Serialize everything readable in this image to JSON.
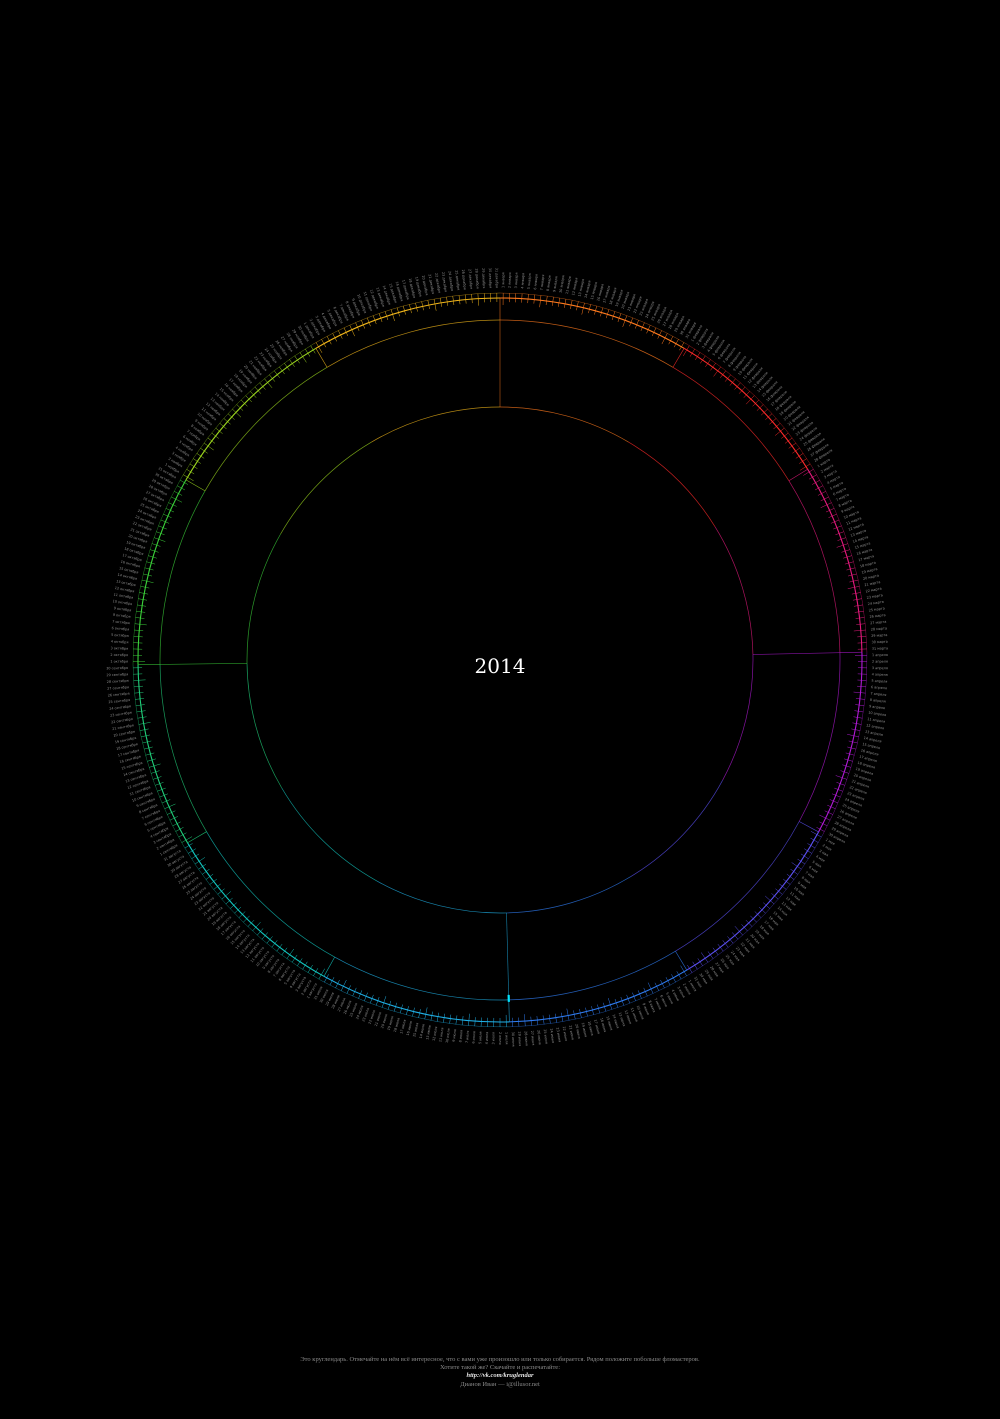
{
  "year": "2014",
  "months": [
    {
      "name": "января",
      "days": 31,
      "color": "#ff7a1e"
    },
    {
      "name": "февраля",
      "days": 28,
      "color": "#ff2a2a"
    },
    {
      "name": "марта",
      "days": 31,
      "color": "#e6197d"
    },
    {
      "name": "апреля",
      "days": 30,
      "color": "#b11ad6"
    },
    {
      "name": "мая",
      "days": 31,
      "color": "#5a4ff0"
    },
    {
      "name": "июня",
      "days": 30,
      "color": "#2f7bf0"
    },
    {
      "name": "июля",
      "days": 31,
      "color": "#1fb0e6"
    },
    {
      "name": "августа",
      "days": 31,
      "color": "#12c6bf"
    },
    {
      "name": "сентября",
      "days": 30,
      "color": "#20cf7a"
    },
    {
      "name": "октября",
      "days": 31,
      "color": "#3bd23a"
    },
    {
      "name": "ноября",
      "days": 30,
      "color": "#9bd51e"
    },
    {
      "name": "декабря",
      "days": 31,
      "color": "#f0b51a"
    }
  ],
  "today_marker": {
    "month": "июля",
    "day": 1,
    "color": "#00e5ff"
  },
  "footer": {
    "line1": "Это круглендарь. Отмечайте на нём всё интересное, что с вами уже произошло или только собирается. Рядом положите побольше фломастеров.",
    "line2": "Хотите такой же? Скачайте и распечатайте:",
    "link": "http://vk.com/kruglendar",
    "author": "Дианов Иван — i@illusor.net"
  }
}
